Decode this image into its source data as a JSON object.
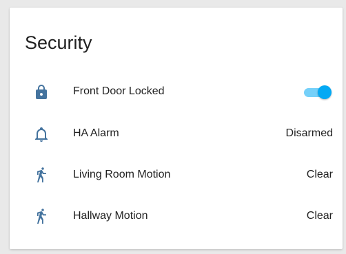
{
  "card": {
    "title": "Security",
    "entities": [
      {
        "icon": "lock-icon",
        "name": "Front Door Locked",
        "state_type": "toggle",
        "toggle_on": true
      },
      {
        "icon": "bell-icon",
        "name": "HA Alarm",
        "state": "Disarmed"
      },
      {
        "icon": "walk-icon",
        "name": "Living Room Motion",
        "state": "Clear"
      },
      {
        "icon": "walk-icon",
        "name": "Hallway Motion",
        "state": "Clear"
      }
    ]
  },
  "colors": {
    "icon": "#44739e",
    "toggle_on": "#03a9f4",
    "text": "#212121",
    "background": "#e9e9e9",
    "card": "#ffffff"
  }
}
